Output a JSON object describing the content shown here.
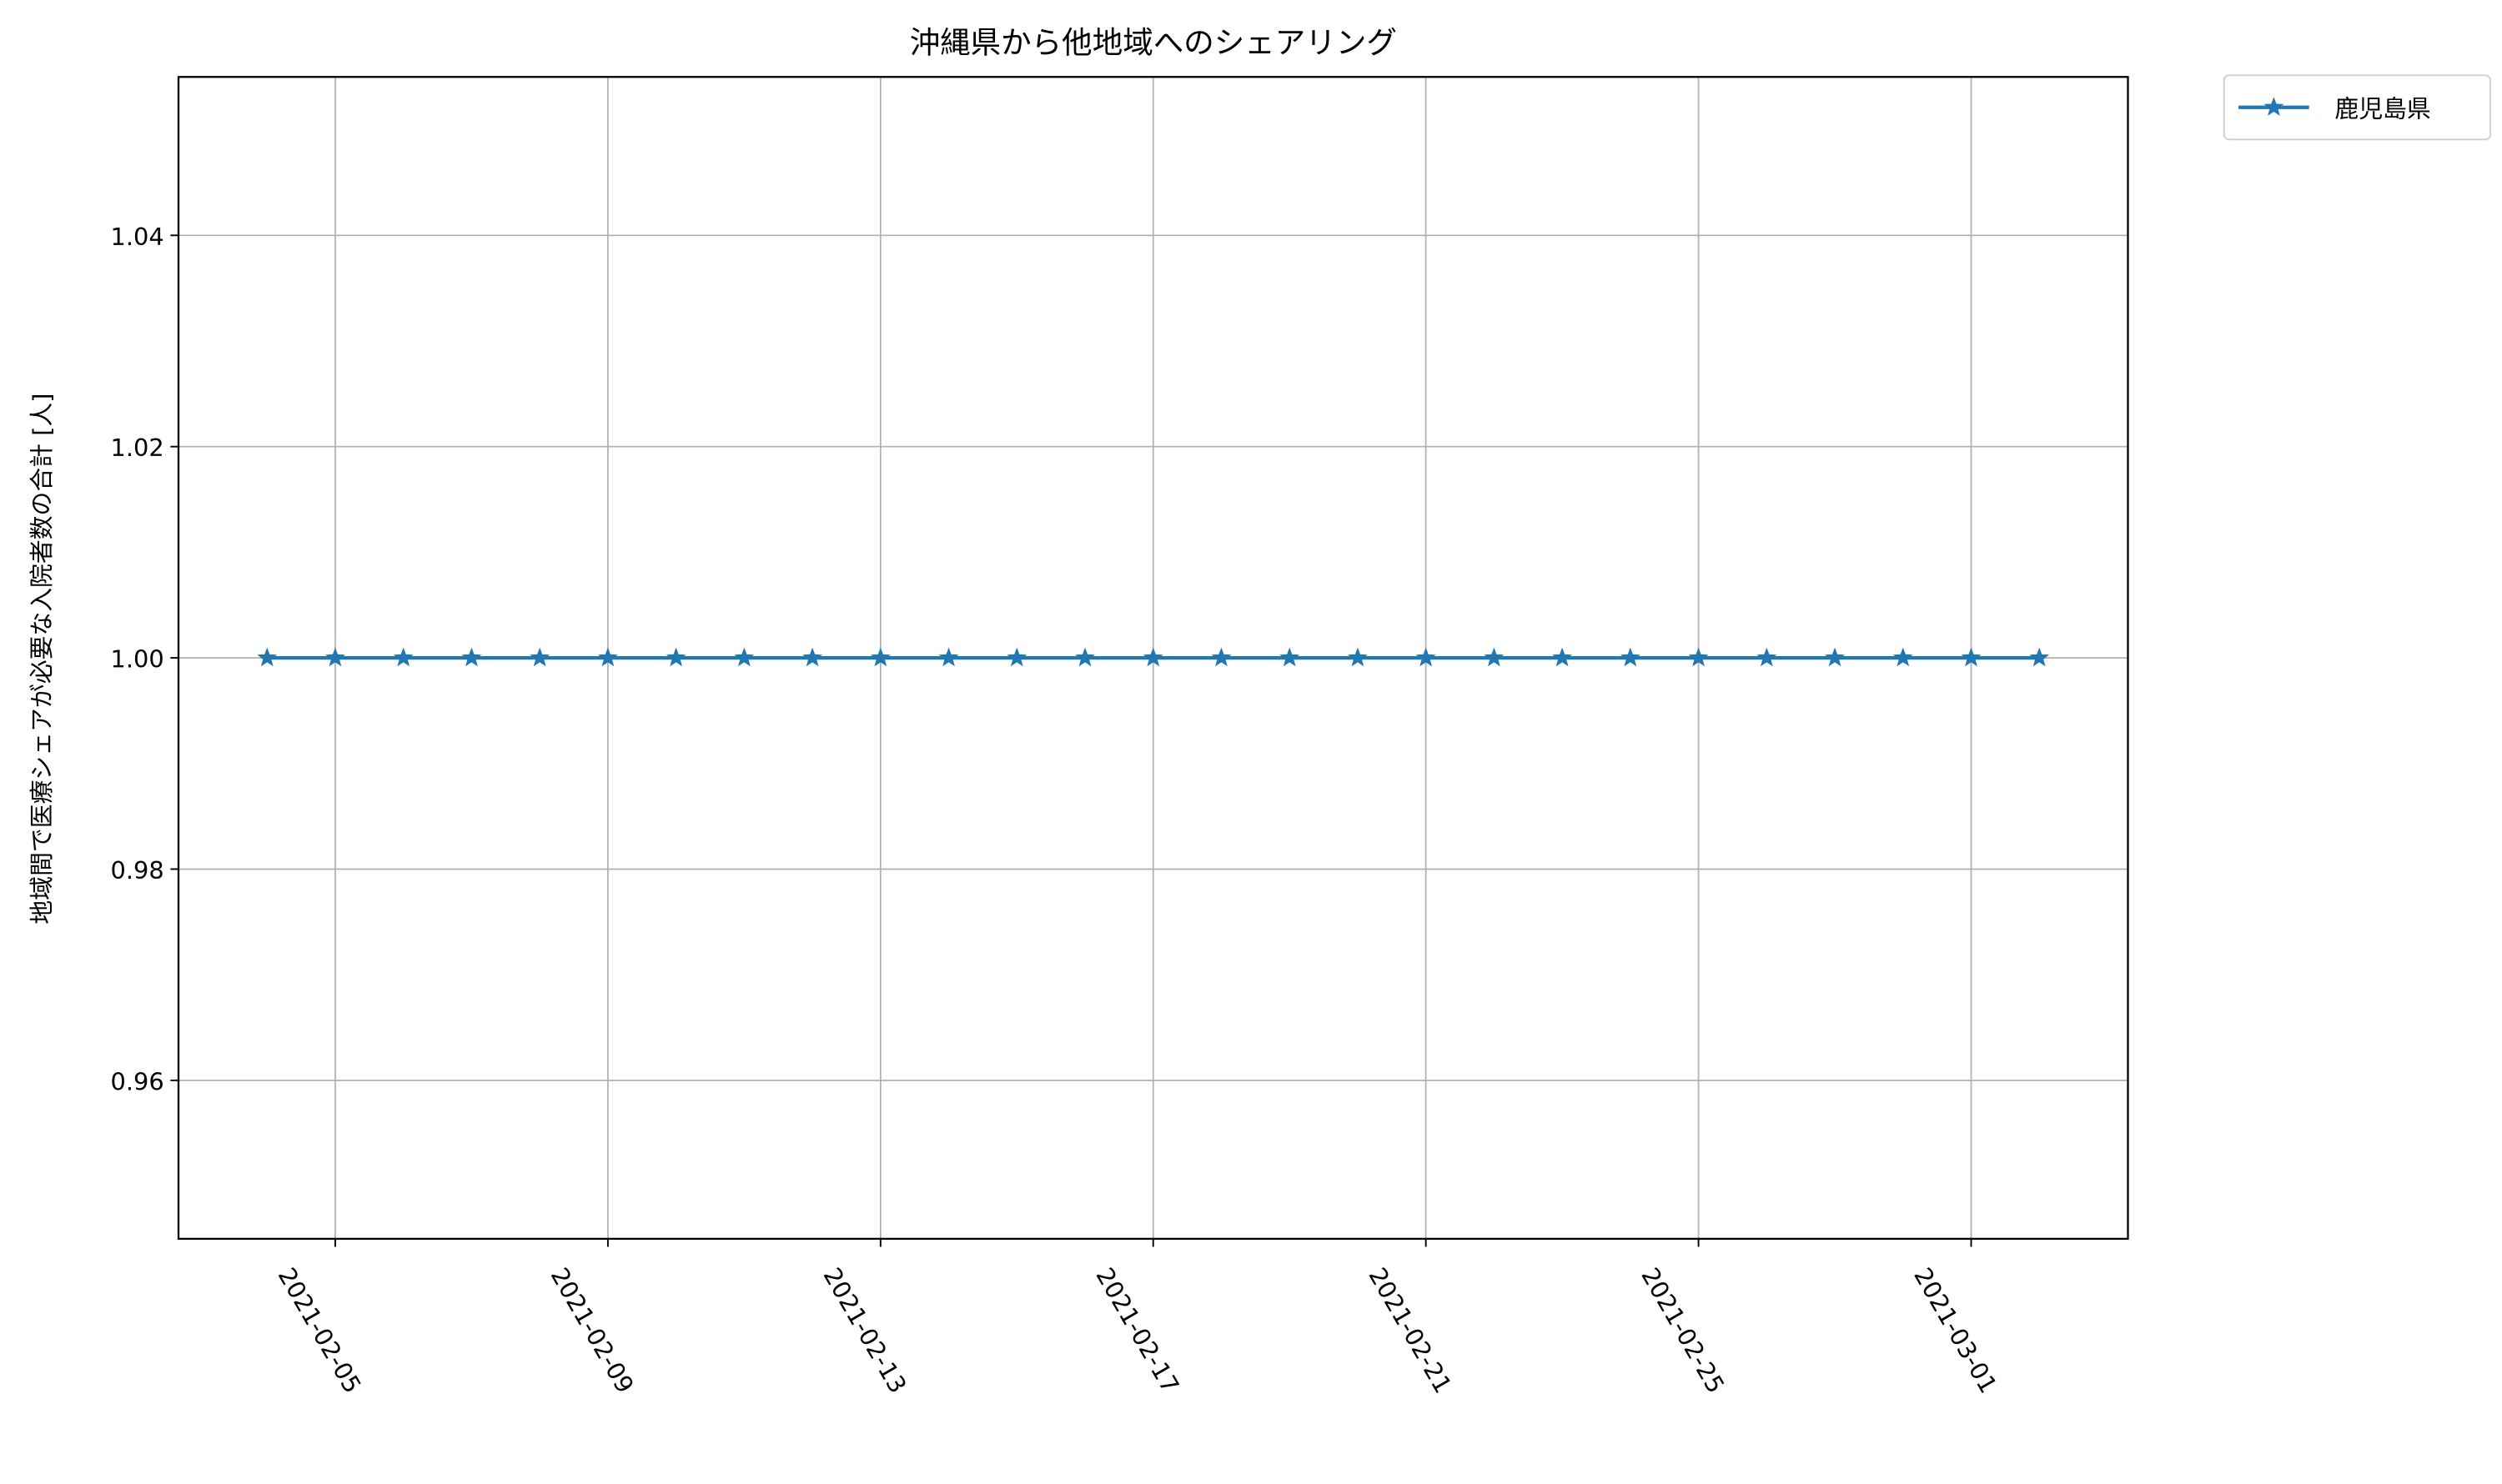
{
  "chart_data": {
    "type": "line",
    "title": "沖縄県から他地域へのシェアリング",
    "xlabel": "",
    "ylabel": "地域間で医療シェアが必要な入院者数の合計 [人]",
    "x": [
      "2021-02-04",
      "2021-02-05",
      "2021-02-06",
      "2021-02-07",
      "2021-02-08",
      "2021-02-09",
      "2021-02-10",
      "2021-02-11",
      "2021-02-12",
      "2021-02-13",
      "2021-02-14",
      "2021-02-15",
      "2021-02-16",
      "2021-02-17",
      "2021-02-18",
      "2021-02-19",
      "2021-02-20",
      "2021-02-21",
      "2021-02-22",
      "2021-02-23",
      "2021-02-24",
      "2021-02-25",
      "2021-02-26",
      "2021-02-27",
      "2021-02-28",
      "2021-03-01",
      "2021-03-02"
    ],
    "series": [
      {
        "name": "鹿児島県",
        "color": "#1f77b4",
        "marker": "star",
        "values": [
          1,
          1,
          1,
          1,
          1,
          1,
          1,
          1,
          1,
          1,
          1,
          1,
          1,
          1,
          1,
          1,
          1,
          1,
          1,
          1,
          1,
          1,
          1,
          1,
          1,
          1,
          1
        ]
      }
    ],
    "xticks": [
      "2021-02-05",
      "2021-02-09",
      "2021-02-13",
      "2021-02-17",
      "2021-02-21",
      "2021-02-25",
      "2021-03-01"
    ],
    "yticks": [
      0.96,
      0.98,
      1.0,
      1.02,
      1.04
    ],
    "ytick_labels": [
      "0.96",
      "0.98",
      "1.00",
      "1.02",
      "1.04"
    ],
    "ylim": [
      0.945,
      1.055
    ],
    "grid": true,
    "legend": "outside-top-right"
  }
}
